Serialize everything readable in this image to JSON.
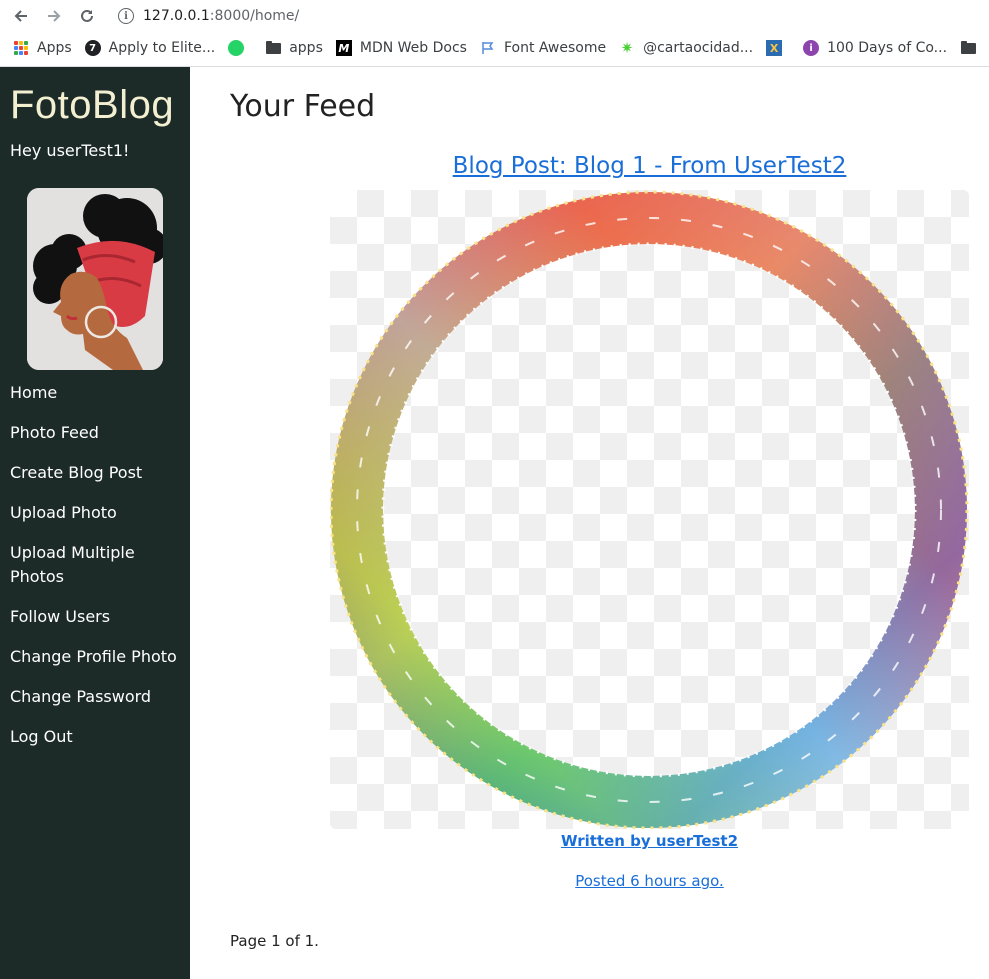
{
  "browser": {
    "url_host": "127.0.0.1",
    "url_path": ":8000/home/",
    "bookmarks": [
      {
        "label": "Apps",
        "icon": "apps-grid-icon"
      },
      {
        "label": "Apply to Elite...",
        "icon": "elite-icon"
      },
      {
        "label": "",
        "icon": "whatsapp-icon"
      },
      {
        "label": "apps",
        "icon": "folder-icon"
      },
      {
        "label": "MDN Web Docs",
        "icon": "mdn-icon"
      },
      {
        "label": "Font Awesome",
        "icon": "flag-icon"
      },
      {
        "label": "@cartaocidad...",
        "icon": "sparkle-icon"
      },
      {
        "label": "",
        "icon": "x-box-icon"
      },
      {
        "label": "100 Days of Co...",
        "icon": "badge-icon"
      },
      {
        "label": "",
        "icon": "folder-icon"
      }
    ]
  },
  "sidebar": {
    "brand": "FotoBlog",
    "greeting": "Hey userTest1!",
    "menu": [
      {
        "label": "Home"
      },
      {
        "label": "Photo Feed"
      },
      {
        "label": "Create Blog Post"
      },
      {
        "label": "Upload Photo"
      },
      {
        "label": "Upload Multiple Photos"
      },
      {
        "label": "Follow Users"
      },
      {
        "label": "Change Profile Photo"
      },
      {
        "label": "Change Password"
      },
      {
        "label": "Log Out"
      }
    ]
  },
  "main": {
    "title": "Your Feed",
    "post": {
      "title": "Blog Post: Blog 1 - From UserTest2",
      "author": "Written by userTest2",
      "posted": "Posted 6 hours ago."
    },
    "pagination": "Page 1 of 1."
  },
  "colors": {
    "sidebar_bg": "#1c2a28",
    "brand": "#f3f0d2",
    "link": "#1a6ed8"
  }
}
